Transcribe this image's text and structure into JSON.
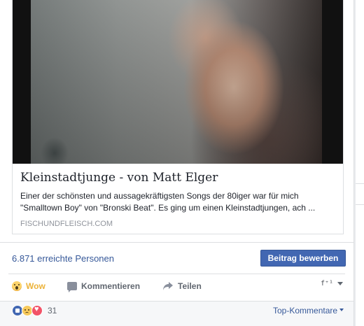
{
  "link_card": {
    "title": "Kleinstadtjunge - von Matt Elger",
    "description_line1": "Einer der schönsten und aussagekräftigsten Songs der 80iger war für mich",
    "description_line2": "\"Smalltown Boy\" von \"Bronski Beat\". Es ging um einen Kleinstadtjungen, ach ...",
    "domain": "FISCHUNDFLEISCH.COM"
  },
  "reach": {
    "text": "6.871 erreichte Personen",
    "boost_button": "Beitrag bewerben"
  },
  "actions": {
    "wow": "Wow",
    "comment": "Kommentieren",
    "share": "Teilen",
    "audience_icon": "pages-icon"
  },
  "reactions": {
    "count": "31",
    "icons": [
      "like-icon",
      "sad-icon",
      "love-icon"
    ],
    "sort_label": "Top-Kommentare"
  },
  "colors": {
    "link_blue": "#365899",
    "button_blue": "#4267b2",
    "wow_yellow": "#ecb33a"
  }
}
